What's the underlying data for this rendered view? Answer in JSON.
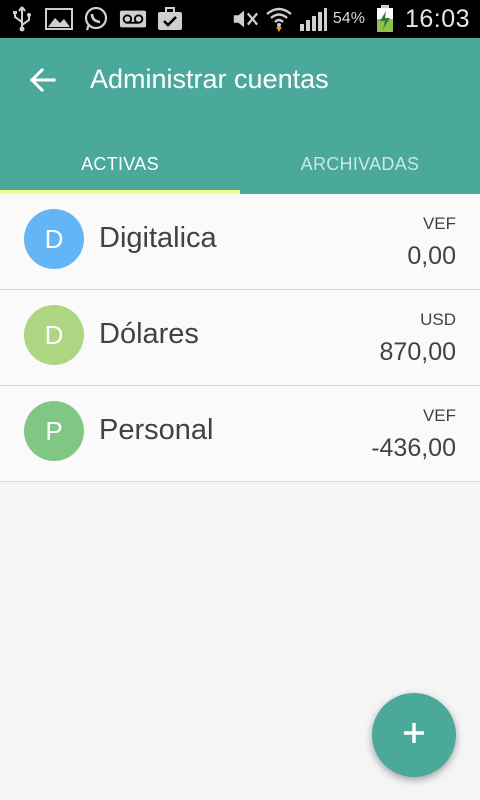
{
  "status_bar": {
    "icons_left": [
      "usb-icon",
      "image-icon",
      "whatsapp-icon",
      "voicemail-icon",
      "briefcase-check-icon"
    ],
    "icons_right": [
      "mute-icon",
      "wifi-icon",
      "signal-icon",
      "battery-charging-icon"
    ],
    "battery_percent": "54%",
    "time": "16:03"
  },
  "header": {
    "title": "Administrar cuentas",
    "back_icon": "arrow-back-icon",
    "color": "#4aa99a"
  },
  "tabs": [
    {
      "label": "ACTIVAS",
      "active": true
    },
    {
      "label": "ARCHIVADAS",
      "active": false
    }
  ],
  "tab_indicator_color": "#e9ff8e",
  "accounts": [
    {
      "initial": "D",
      "name": "Digitalica",
      "currency": "VEF",
      "amount": "0,00",
      "avatar_color": "#64b5f6"
    },
    {
      "initial": "D",
      "name": "Dólares",
      "currency": "USD",
      "amount": "870,00",
      "avatar_color": "#aed581"
    },
    {
      "initial": "P",
      "name": "Personal",
      "currency": "VEF",
      "amount": "-436,00",
      "avatar_color": "#81c784"
    }
  ],
  "fab": {
    "icon": "plus-icon",
    "color": "#4aa99a"
  }
}
